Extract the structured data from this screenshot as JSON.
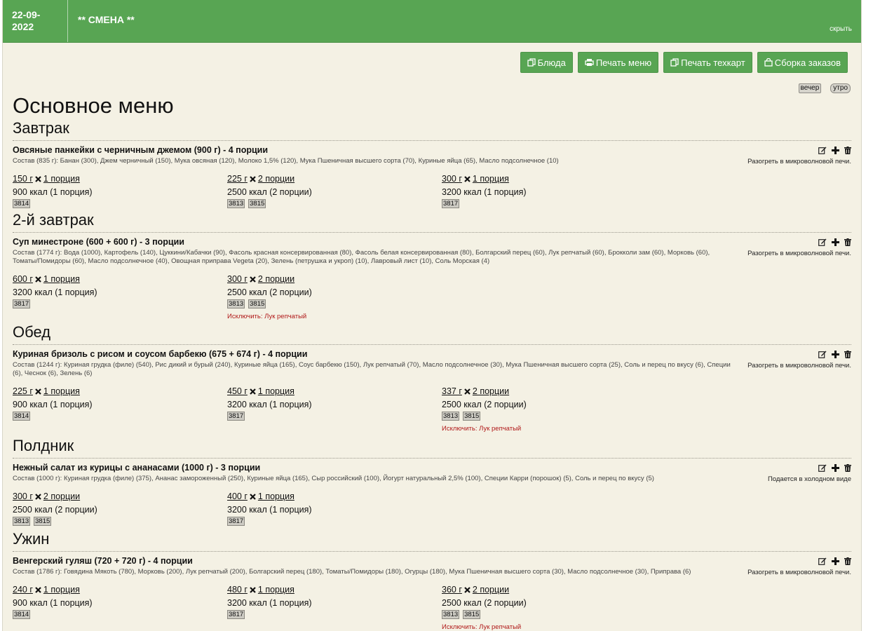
{
  "header": {
    "date": "22-09-2022",
    "shift": "** СМЕНА **",
    "hide": "скрыть"
  },
  "toolbar": {
    "dishes": "Блюда",
    "print_menu": "Печать меню",
    "print_techcard": "Печать техкарт",
    "assemble_orders": "Сборка заказов"
  },
  "tags": {
    "evening": "вечер",
    "morning": "утро"
  },
  "page_title": "Основное меню",
  "sections": [
    {
      "title": "Завтрак",
      "dish": {
        "name": "Овсяные панкейки с черничным джемом (900 г) - 4 порции",
        "composition": "Состав (835 г): Банан (300), Джем черничный (150), Мука овсяная (120), Молоко 1,5% (120), Мука Пшеничная высшего сорта (70), Куриные яйца (65), Масло подсолнечное (10)",
        "note": "Разогреть в микроволновой печи.",
        "portions": [
          {
            "weight": "150 г",
            "count": "1 порция",
            "kcal": "900 ккал (1 порция)",
            "codes": [
              "3814"
            ],
            "exclude": ""
          },
          {
            "weight": "225 г",
            "count": "2 порции",
            "kcal": "2500 ккал (2 порции)",
            "codes": [
              "3813",
              "3815"
            ],
            "exclude": ""
          },
          {
            "weight": "300 г",
            "count": "1 порция",
            "kcal": "3200 ккал (1 порция)",
            "codes": [
              "3817"
            ],
            "exclude": ""
          }
        ]
      }
    },
    {
      "title": "2-й завтрак",
      "dish": {
        "name": "Суп минестроне (600 + 600 г) - 3 порции",
        "composition": "Состав (1774 г): Вода (1000), Картофель (140), Цуккини/Кабачки (90), Фасоль красная консервированная (80), Фасоль белая консервированная (80), Болгарский перец (60), Лук репчатый (60), Брокколи зам (60), Морковь (60), Томаты/Помидоры (60), Масло подсолнечное (40), Овощная приправа Vegeta (20), Зелень (петрушка и укроп) (10), Лавровый лист (10), Соль Морская (4)",
        "note": "Разогреть в микроволновой печи.",
        "portions": [
          {
            "weight": "600 г",
            "count": "1 порция",
            "kcal": "3200 ккал (1 порция)",
            "codes": [
              "3817"
            ],
            "exclude": ""
          },
          {
            "weight": "300 г",
            "count": "2 порции",
            "kcal": "2500 ккал (2 порции)",
            "codes": [
              "3813",
              "3815"
            ],
            "exclude": "Исключить: Лук репчатый"
          }
        ]
      }
    },
    {
      "title": "Обед",
      "dish": {
        "name": "Куриная бризоль с рисом и соусом барбекю (675 + 674 г) - 4 порции",
        "composition": "Состав (1244 г): Куриная грудка (филе) (540), Рис дикий и бурый (240), Куриные яйца (165), Соус барбекю (150), Лук репчатый (70), Масло подсолнечное (30), Мука Пшеничная высшего сорта (25), Соль и перец по вкусу (6), Специи (6), Чеснок (6), Зелень (6)",
        "note": "Разогреть в микроволновой печи.",
        "portions": [
          {
            "weight": "225 г",
            "count": "1 порция",
            "kcal": "900 ккал (1 порция)",
            "codes": [
              "3814"
            ],
            "exclude": ""
          },
          {
            "weight": "450 г",
            "count": "1 порция",
            "kcal": "3200 ккал (1 порция)",
            "codes": [
              "3817"
            ],
            "exclude": ""
          },
          {
            "weight": "337 г",
            "count": "2 порции",
            "kcal": "2500 ккал (2 порции)",
            "codes": [
              "3813",
              "3815"
            ],
            "exclude": "Исключить: Лук репчатый"
          }
        ]
      }
    },
    {
      "title": "Полдник",
      "dish": {
        "name": "Нежный салат из курицы с ананасами (1000 г) - 3 порции",
        "composition": "Состав (1000 г): Куриная грудка (филе) (375), Ананас замороженный (250), Куриные яйца (165), Сыр российский (100), Йогурт натуральный 2,5% (100), Специи Карри (порошок) (5), Соль и перец по вкусу (5)",
        "note": "Подается в холодном виде",
        "portions": [
          {
            "weight": "300 г",
            "count": "2 порции",
            "kcal": "2500 ккал (2 порции)",
            "codes": [
              "3813",
              "3815"
            ],
            "exclude": ""
          },
          {
            "weight": "400 г",
            "count": "1 порция",
            "kcal": "3200 ккал (1 порция)",
            "codes": [
              "3817"
            ],
            "exclude": ""
          }
        ]
      }
    },
    {
      "title": "Ужин",
      "dish": {
        "name": "Венгерский гуляш (720 + 720 г) - 4 порции",
        "composition": "Состав (1786 г): Говядина Мякоть (780), Морковь (200), Лук репчатый (200), Болгарский перец (180), Томаты/Помидоры (180), Огурцы (180), Мука Пшеничная высшего сорта (30), Масло подсолнечное (30), Приправа (6)",
        "note": "Разогреть в микроволновой печи.",
        "portions": [
          {
            "weight": "240 г",
            "count": "1 порция",
            "kcal": "900 ккал (1 порция)",
            "codes": [
              "3814"
            ],
            "exclude": ""
          },
          {
            "weight": "480 г",
            "count": "1 порция",
            "kcal": "3200 ккал (1 порция)",
            "codes": [
              "3817"
            ],
            "exclude": ""
          },
          {
            "weight": "360 г",
            "count": "2 порции",
            "kcal": "2500 ккал (2 порции)",
            "codes": [
              "3813",
              "3815"
            ],
            "exclude": "Исключить: Лук репчатый"
          }
        ]
      }
    }
  ]
}
